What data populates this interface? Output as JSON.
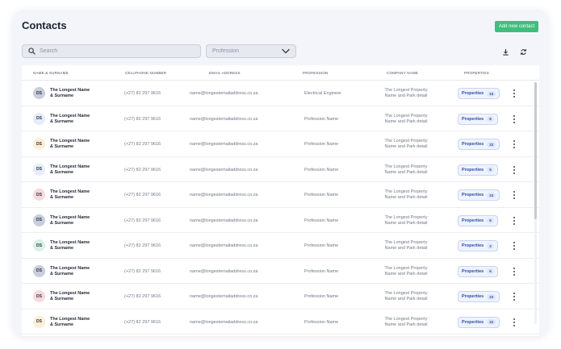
{
  "header": {
    "title": "Contacts",
    "add_button_label": "Add new contact"
  },
  "filters": {
    "search_placeholder": "Search",
    "profession_selected": "Profession",
    "download_icon": "download-icon",
    "refresh_icon": "refresh-icon"
  },
  "table": {
    "columns": [
      "NAME & SURNAME",
      "CELLPHONE NUMBER",
      "EMAIL ADDRESS",
      "PROFESSION",
      "COMPANY NAME",
      "PROPERTIES"
    ],
    "rows": [
      {
        "initials": "DS",
        "avatar_color": "#c8cedc",
        "name_line1": "The Longest Name",
        "name_line2": "& Surname",
        "phone": "(+27) 82 297 9616",
        "email": "name@longestemailaddress.co.za",
        "profession": "Electrical Engineer",
        "company_line1": "The Longest Property",
        "company_line2": "Name and Park detail",
        "properties_label": "Properties",
        "properties_count": "15"
      },
      {
        "initials": "DS",
        "avatar_color": "#e7ecf8",
        "name_line1": "The Longest Name",
        "name_line2": "& Surname",
        "phone": "(+27) 82 297 9616",
        "email": "name@longestemailaddress.co.za",
        "profession": "Profession Name",
        "company_line1": "The Longest Property",
        "company_line2": "Name and Park detail",
        "properties_label": "Properties",
        "properties_count": "8"
      },
      {
        "initials": "DS",
        "avatar_color": "#fbefd4",
        "name_line1": "The Longest Name",
        "name_line2": "& Surname",
        "phone": "(+27) 82 297 9616",
        "email": "name@longestemailaddress.co.za",
        "profession": "Profession Name",
        "company_line1": "The Longest Property",
        "company_line2": "Name and Park detail",
        "properties_label": "Properties",
        "properties_count": "22"
      },
      {
        "initials": "DS",
        "avatar_color": "#e7ecf8",
        "name_line1": "The Longest Name",
        "name_line2": "& Surname",
        "phone": "(+27) 82 297 9616",
        "email": "name@longestemailaddress.co.za",
        "profession": "Profession Name",
        "company_line1": "The Longest Property",
        "company_line2": "Name and Park detail",
        "properties_label": "Properties",
        "properties_count": "5"
      },
      {
        "initials": "DS",
        "avatar_color": "#f8d9dc",
        "name_line1": "The Longest Name",
        "name_line2": "& Surname",
        "phone": "(+27) 82 297 9616",
        "email": "name@longestemailaddress.co.za",
        "profession": "Profession Name",
        "company_line1": "The Longest Property",
        "company_line2": "Name and Park detail",
        "properties_label": "Properties",
        "properties_count": "23"
      },
      {
        "initials": "DS",
        "avatar_color": "#c8cedc",
        "name_line1": "The Longest Name",
        "name_line2": "& Surname",
        "phone": "(+27) 82 297 9616",
        "email": "name@longestemailaddress.co.za",
        "profession": "Profession Name",
        "company_line1": "The Longest Property",
        "company_line2": "Name and Park detail",
        "properties_label": "Properties",
        "properties_count": "6"
      },
      {
        "initials": "DS",
        "avatar_color": "#d9f1e6",
        "name_line1": "The Longest Name",
        "name_line2": "& Surname",
        "phone": "(+27) 82 297 9616",
        "email": "name@longestemailaddress.co.za",
        "profession": "Profession Name",
        "company_line1": "The Longest Property",
        "company_line2": "Name and Park detail",
        "properties_label": "Properties",
        "properties_count": "3"
      },
      {
        "initials": "DS",
        "avatar_color": "#c8cedc",
        "name_line1": "The Longest Name",
        "name_line2": "& Surname",
        "phone": "(+27) 82 297 9616",
        "email": "name@longestemailaddress.co.za",
        "profession": "Profession Name",
        "company_line1": "The Longest Property",
        "company_line2": "Name and Park detail",
        "properties_label": "Properties",
        "properties_count": "6"
      },
      {
        "initials": "DS",
        "avatar_color": "#f8d9dc",
        "name_line1": "The Longest Name",
        "name_line2": "& Surname",
        "phone": "(+27) 82 297 9616",
        "email": "name@longestemailaddress.co.za",
        "profession": "Profession Name",
        "company_line1": "The Longest Property",
        "company_line2": "Name and Park detail",
        "properties_label": "Properties",
        "properties_count": "23"
      },
      {
        "initials": "DS",
        "avatar_color": "#fbefd4",
        "name_line1": "The Longest Name",
        "name_line2": "& Surname",
        "phone": "(+27) 82 297 9616",
        "email": "name@longestemailaddress.co.za",
        "profession": "Profession Name",
        "company_line1": "The Longest Property",
        "company_line2": "Name and Park detail",
        "properties_label": "Properties",
        "properties_count": "22"
      }
    ]
  },
  "colors": {
    "accent_green": "#3fbe7d",
    "badge_blue": "#2d4fa8"
  }
}
